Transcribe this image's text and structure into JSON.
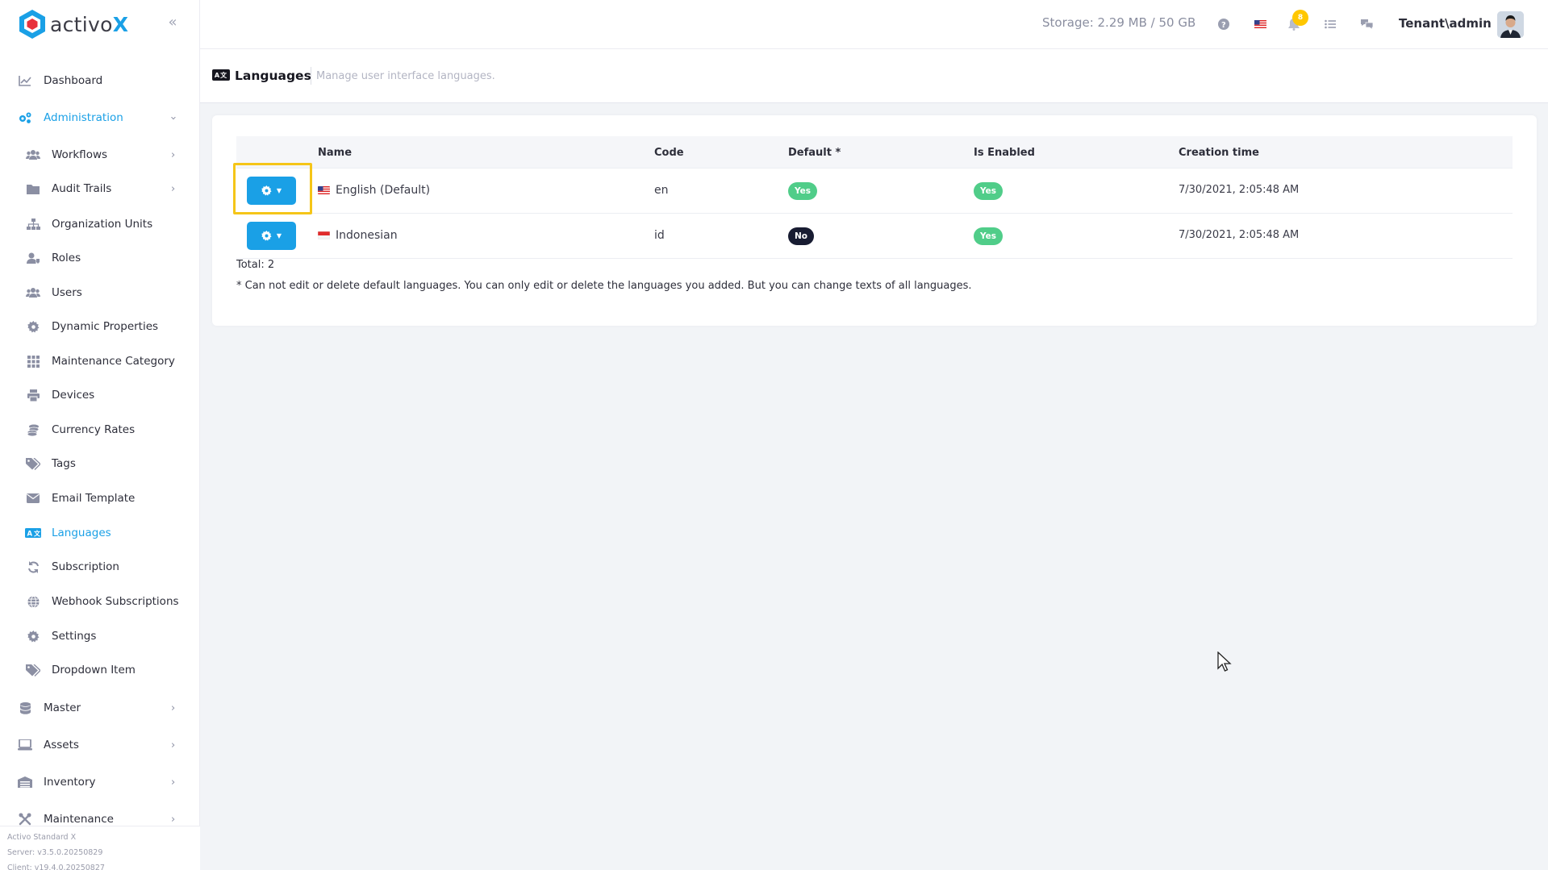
{
  "brand": {
    "name_prefix": "activo",
    "name_suffix": "X",
    "accent": "#1aa0e6"
  },
  "sidebar": {
    "items": [
      {
        "label": "Dashboard",
        "icon": "chart-line-icon"
      },
      {
        "label": "Administration",
        "icon": "cogs-icon",
        "active": true,
        "expanded": true
      },
      {
        "label": "Workflows",
        "icon": "users-icon"
      },
      {
        "label": "Audit Trails",
        "icon": "folder-icon"
      },
      {
        "label": "Organization Units",
        "icon": "sitemap-icon"
      },
      {
        "label": "Roles",
        "icon": "user-tag-icon"
      },
      {
        "label": "Users",
        "icon": "users-icon"
      },
      {
        "label": "Dynamic Properties",
        "icon": "gear-icon"
      },
      {
        "label": "Maintenance Category",
        "icon": "grid-icon"
      },
      {
        "label": "Devices",
        "icon": "printer-icon"
      },
      {
        "label": "Currency Rates",
        "icon": "coins-icon"
      },
      {
        "label": "Tags",
        "icon": "tags-icon"
      },
      {
        "label": "Email Template",
        "icon": "envelope-icon"
      },
      {
        "label": "Languages",
        "icon": "language-icon",
        "active": true
      },
      {
        "label": "Subscription",
        "icon": "sync-icon"
      },
      {
        "label": "Webhook Subscriptions",
        "icon": "globe-icon"
      },
      {
        "label": "Settings",
        "icon": "gear-icon"
      },
      {
        "label": "Dropdown Item",
        "icon": "tags-icon"
      },
      {
        "label": "Master",
        "icon": "database-icon"
      },
      {
        "label": "Assets",
        "icon": "laptop-icon"
      },
      {
        "label": "Inventory",
        "icon": "warehouse-icon"
      },
      {
        "label": "Maintenance",
        "icon": "tools-icon"
      }
    ],
    "footer": {
      "product": "Activo Standard X",
      "server": "Server: v3.5.0.20250829",
      "client": "Client: v19.4.0.20250827"
    }
  },
  "header": {
    "storage": "Storage: 2.29 MB / 50 GB",
    "notification_count": "8",
    "user": "Tenant\\admin"
  },
  "page": {
    "icon_text": "A文",
    "title": "Languages",
    "description": "Manage user interface languages."
  },
  "table": {
    "columns": [
      "Name",
      "Code",
      "Default *",
      "Is Enabled",
      "Creation time"
    ],
    "rows": [
      {
        "name": "English (Default)",
        "code": "en",
        "default": "Yes",
        "enabled": "Yes",
        "created": "7/30/2021, 2:05:48 AM",
        "flag": "us"
      },
      {
        "name": "Indonesian",
        "code": "id",
        "default": "No",
        "enabled": "Yes",
        "created": "7/30/2021, 2:05:48 AM",
        "flag": "id"
      }
    ],
    "total": "Total: 2",
    "note": "* Can not edit or delete default languages. You can only edit or delete the languages you added. But you can change texts of all languages."
  }
}
